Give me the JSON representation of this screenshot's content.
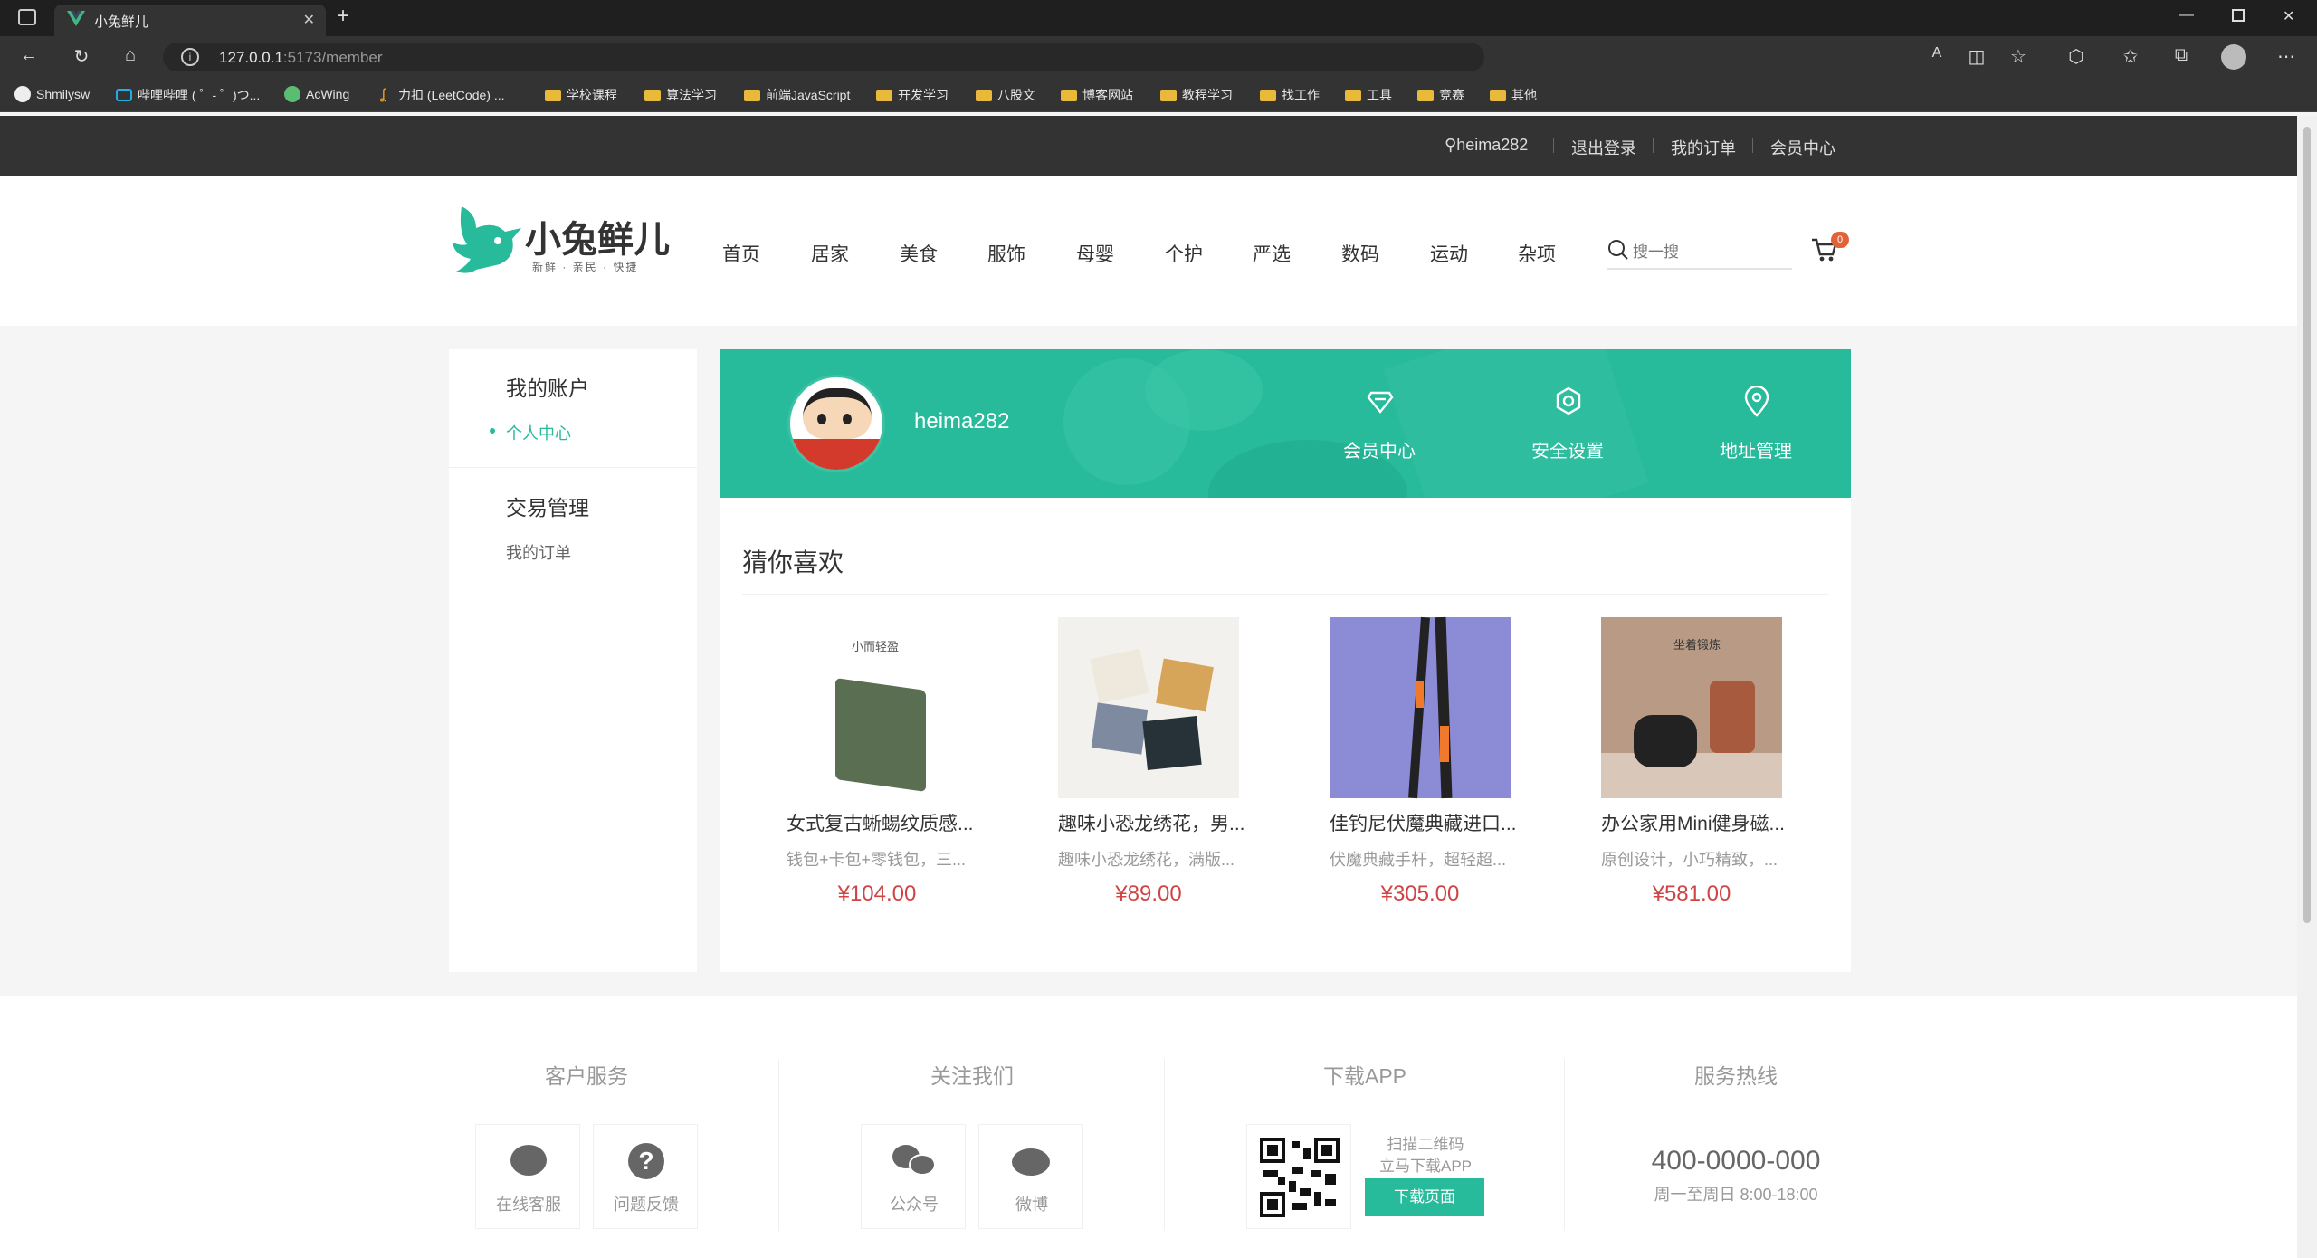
{
  "browser": {
    "tab_title": "小兔鲜儿",
    "url_host": "127.0.0.1",
    "url_rest": ":5173/member",
    "bookmarks": [
      "Shmilysw",
      "哔哩哔哩 ( ゜- ゜)つ...",
      "AcWing",
      "力扣 (LeetCode) ...",
      "学校课程",
      "算法学习",
      "前端JavaScript",
      "开发学习",
      "八股文",
      "博客网站",
      "教程学习",
      "找工作",
      "工具",
      "竞赛",
      "其他"
    ]
  },
  "topnav": {
    "username": "heima282",
    "logout": "退出登录",
    "orders": "我的订单",
    "member": "会员中心"
  },
  "header": {
    "logo_text": "小兔鲜儿",
    "logo_sub": "新鲜 · 亲民 · 快捷",
    "nav": [
      "首页",
      "居家",
      "美食",
      "服饰",
      "母婴",
      "个护",
      "严选",
      "数码",
      "运动",
      "杂项"
    ],
    "search_placeholder": "搜一搜",
    "cart_count": "0"
  },
  "sidebar": {
    "account_title": "我的账户",
    "account_link": "个人中心",
    "trade_title": "交易管理",
    "trade_link": "我的订单"
  },
  "banner": {
    "username": "heima282",
    "items": [
      "会员中心",
      "安全设置",
      "地址管理"
    ]
  },
  "guess": {
    "title": "猜你喜欢",
    "goods": [
      {
        "name": "女式复古蜥蜴纹质感...",
        "desc": "钱包+卡包+零钱包，三...",
        "price": "¥104.00"
      },
      {
        "name": "趣味小恐龙绣花，男...",
        "desc": "趣味小恐龙绣花，满版...",
        "price": "¥89.00"
      },
      {
        "name": "佳钓尼伏魔典藏进口...",
        "desc": "伏魔典藏手杆，超轻超...",
        "price": "¥305.00"
      },
      {
        "name": "办公家用Mini健身磁...",
        "desc": "原创设计，小巧精致，...",
        "price": "¥581.00"
      }
    ],
    "img_texts": [
      "小而轻盈",
      "坐着锻炼"
    ]
  },
  "footer": {
    "service_title": "客户服务",
    "service_items": [
      "在线客服",
      "问题反馈"
    ],
    "follow_title": "关注我们",
    "follow_items": [
      "公众号",
      "微博"
    ],
    "app_title": "下载APP",
    "app_tip1": "扫描二维码",
    "app_tip2": "立马下载APP",
    "app_button": "下载页面",
    "hotline_title": "服务热线",
    "hotline_number": "400-0000-000",
    "hotline_hours": "周一至周日 8:00-18:00"
  },
  "colors": {
    "brand": "#27ba9b",
    "price": "#cf4444",
    "topnav": "#333333"
  }
}
